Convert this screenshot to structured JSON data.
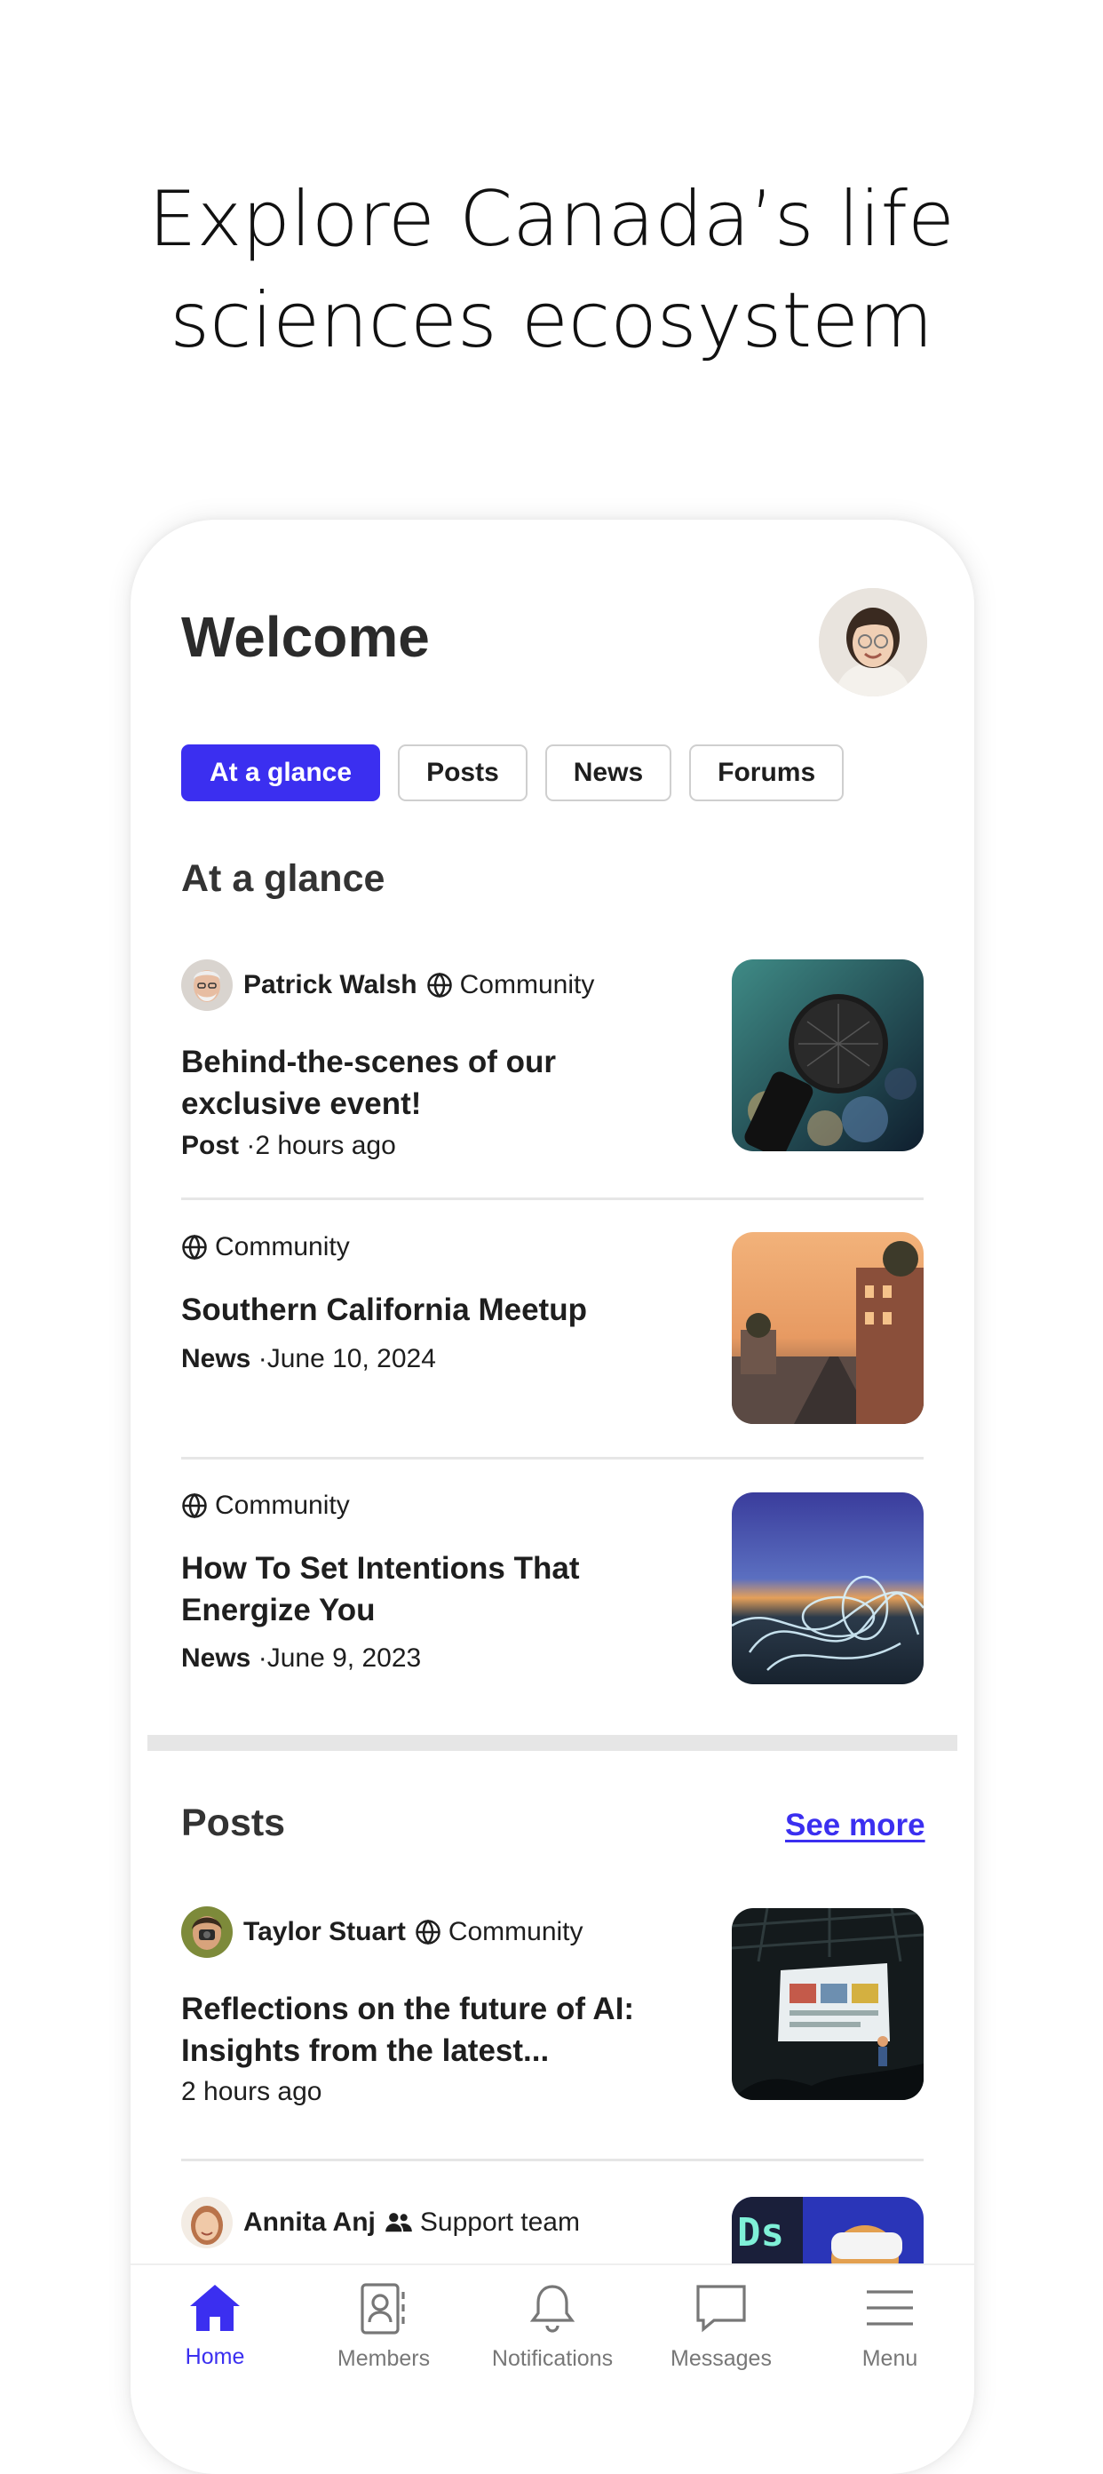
{
  "headline": {
    "line1": "Explore Canada’s life",
    "line2": "sciences ecosystem"
  },
  "header": {
    "title": "Welcome"
  },
  "tabs": [
    {
      "label": "At a glance",
      "active": true
    },
    {
      "label": "Posts",
      "active": false
    },
    {
      "label": "News",
      "active": false
    },
    {
      "label": "Forums",
      "active": false
    }
  ],
  "glance": {
    "title": "At a glance",
    "items": [
      {
        "author": "Patrick Walsh",
        "group": "Community",
        "title_line1": "Behind-the-scenes of our",
        "title_line2": "exclusive event!",
        "type": "Post",
        "time": "·2 hours ago"
      },
      {
        "group": "Community",
        "title_line1": "Southern California Meetup",
        "type": "News",
        "time": "·June 10, 2024"
      },
      {
        "group": "Community",
        "title_line1": "How To Set Intentions That",
        "title_line2": "Energize You",
        "type": "News",
        "time": "·June 9, 2023"
      }
    ]
  },
  "posts": {
    "title": "Posts",
    "see_more": "See more",
    "items": [
      {
        "author": "Taylor Stuart",
        "group": "Community",
        "title_line1": "Reflections on the future of AI:",
        "title_line2": "Insights from the latest...",
        "time": "2 hours ago"
      },
      {
        "author": "Annita Anj",
        "group": "Support team"
      }
    ]
  },
  "nav": [
    {
      "label": "Home",
      "icon": "home-icon",
      "active": true
    },
    {
      "label": "Members",
      "icon": "members-icon",
      "active": false
    },
    {
      "label": "Notifications",
      "icon": "bell-icon",
      "active": false
    },
    {
      "label": "Messages",
      "icon": "chat-icon",
      "active": false
    },
    {
      "label": "Menu",
      "icon": "menu-icon",
      "active": false
    }
  ],
  "colors": {
    "accent": "#3b2ff0",
    "text": "#1e1e1e",
    "divider": "#e6e6e6"
  }
}
